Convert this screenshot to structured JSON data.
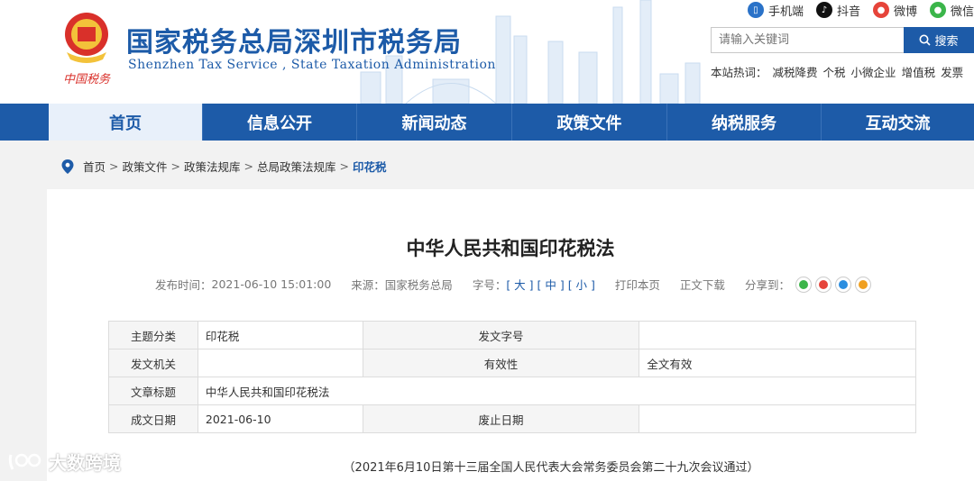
{
  "header": {
    "title": "国家税务总局深圳市税务局",
    "subtitle": "Shenzhen  Tax  Service ,  State Taxation  Administration",
    "emblem_text": "中国税务"
  },
  "top_links": [
    {
      "label": "手机端",
      "icon": "mobile-icon",
      "color": "#2a72c8"
    },
    {
      "label": "抖音",
      "icon": "douyin-icon",
      "color": "#111111"
    },
    {
      "label": "微博",
      "icon": "weibo-icon",
      "color": "#e6443a"
    },
    {
      "label": "微信",
      "icon": "wechat-icon",
      "color": "#3bb54a"
    }
  ],
  "search": {
    "placeholder": "请输入关键词",
    "button_label": "搜索"
  },
  "hot": {
    "label": "本站热词：",
    "words": [
      "减税降费",
      "个税",
      "小微企业",
      "增值税",
      "发票"
    ]
  },
  "nav": {
    "items": [
      "首页",
      "信息公开",
      "新闻动态",
      "政策文件",
      "纳税服务",
      "互动交流"
    ],
    "active_index": 0
  },
  "breadcrumb": [
    "首页",
    "政策文件",
    "政策法规库",
    "总局政策法规库",
    "印花税"
  ],
  "article": {
    "title": "中华人民共和国印花税法",
    "meta": {
      "publish_label": "发布时间：",
      "publish_time": "2021-06-10 15:01:00",
      "source_label": "来源：",
      "source": "国家税务总局",
      "fontsize_label": "字号：",
      "size_large": "[ 大 ]",
      "size_medium": "[ 中 ]",
      "size_small": "[ 小 ]",
      "print": "打印本页",
      "download": "正文下载",
      "share_label": "分享到："
    },
    "share_icons": [
      {
        "name": "wechat-share-icon",
        "color": "#3bb54a"
      },
      {
        "name": "weibo-share-icon",
        "color": "#e6443a"
      },
      {
        "name": "qq-share-icon",
        "color": "#2a8ee0"
      },
      {
        "name": "qzone-share-icon",
        "color": "#f0a020"
      }
    ],
    "info_table": {
      "topic_label": "主题分类",
      "topic": "印花税",
      "doc_no_label": "发文字号",
      "doc_no": "",
      "issuer_label": "发文机关",
      "issuer": "",
      "validity_label": "有效性",
      "validity": "全文有效",
      "article_title_label": "文章标题",
      "article_title": "中华人民共和国印花税法",
      "date_label": "成文日期",
      "date": "2021-06-10",
      "abolish_label": "废止日期",
      "abolish": ""
    },
    "passed_note": "（2021年6月10日第十三届全国人民代表大会常务委员会第二十九次会议通过）"
  },
  "watermark": "大数跨境"
}
